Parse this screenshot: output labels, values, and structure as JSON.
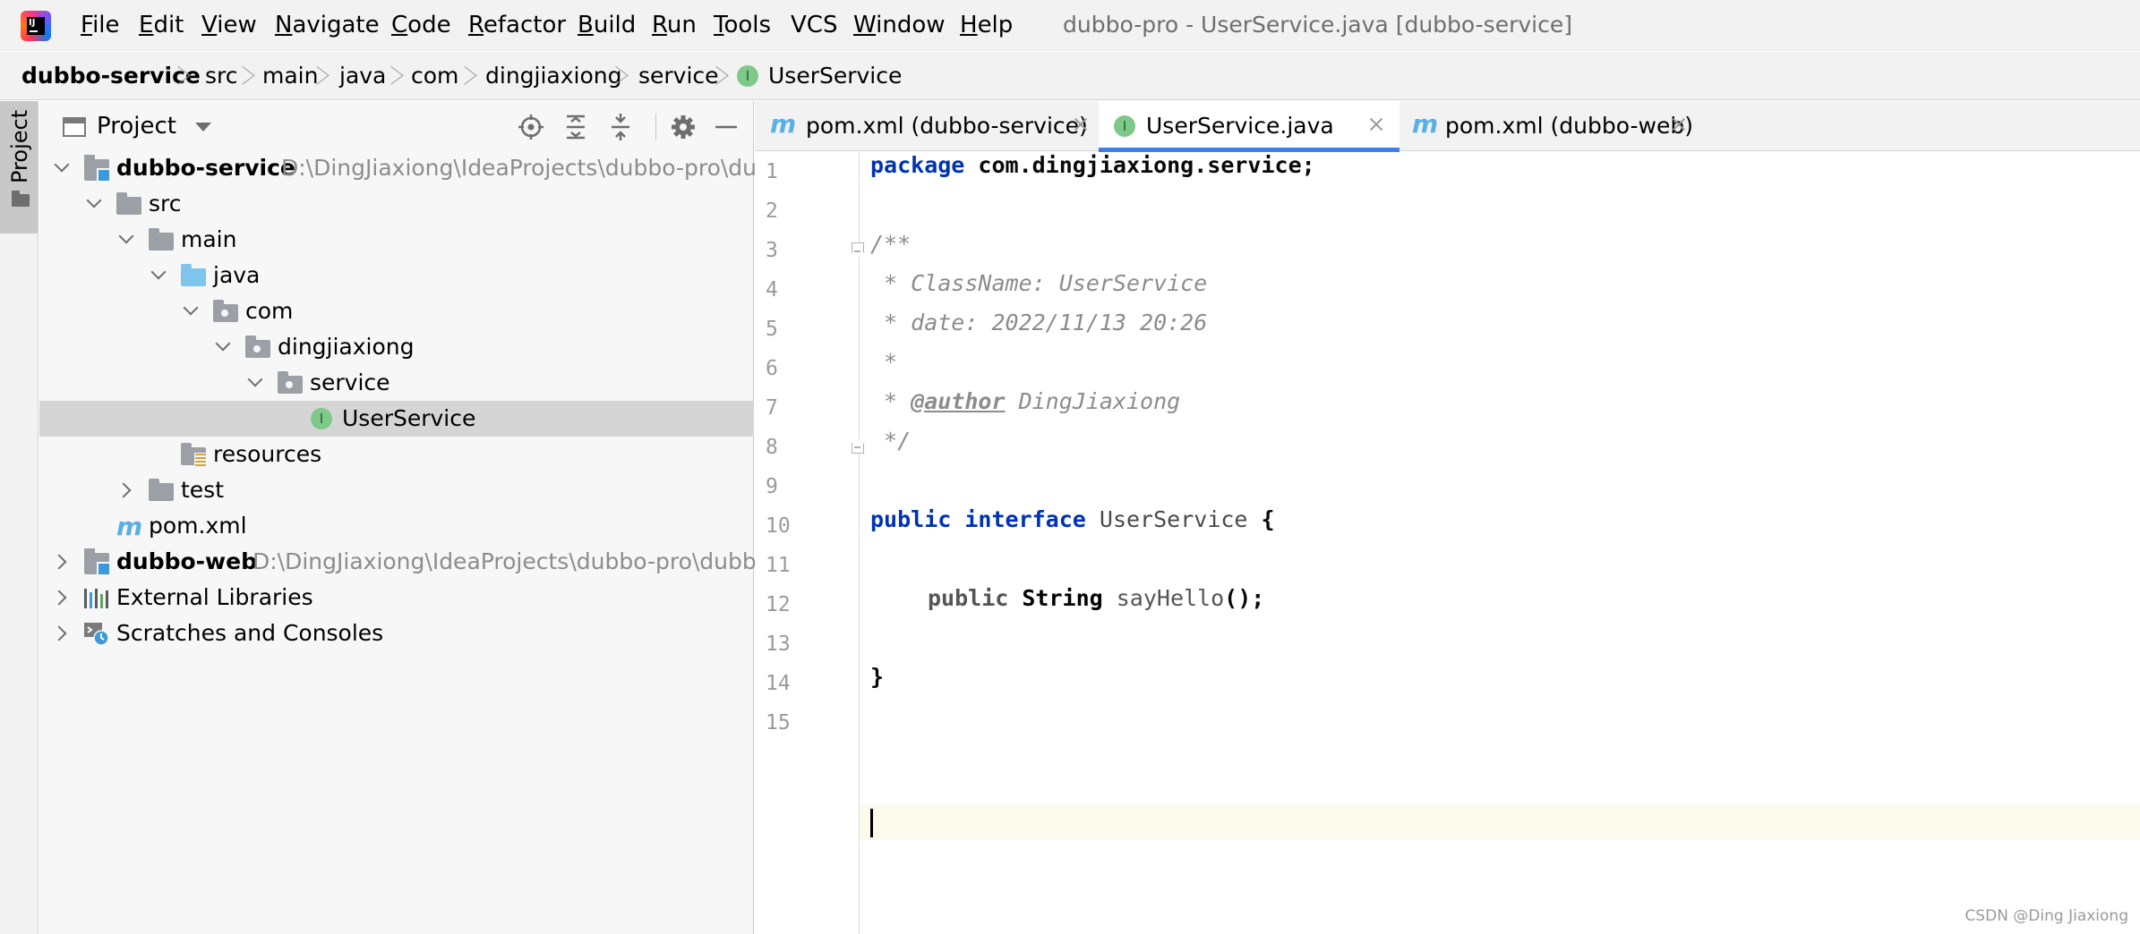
{
  "menubar": {
    "items": [
      {
        "label": "File",
        "mn": "F",
        "rest": "ile"
      },
      {
        "label": "Edit",
        "mn": "E",
        "rest": "dit"
      },
      {
        "label": "View",
        "mn": "V",
        "rest": "iew"
      },
      {
        "label": "Navigate",
        "mn": "N",
        "rest": "avigate"
      },
      {
        "label": "Code",
        "mn": "C",
        "rest": "ode"
      },
      {
        "label": "Refactor",
        "mn": "R",
        "rest": "efactor"
      },
      {
        "label": "Build",
        "mn": "B",
        "rest": "uild"
      },
      {
        "label": "Run",
        "mn": "R",
        "rest": "un"
      },
      {
        "label": "Tools",
        "mn": "T",
        "rest": "ools"
      },
      {
        "label": "VCS",
        "mn": "",
        "rest": "VCS"
      },
      {
        "label": "Window",
        "mn": "W",
        "rest": "indow"
      },
      {
        "label": "Help",
        "mn": "H",
        "rest": "elp"
      }
    ],
    "window_title": "dubbo-pro - UserService.java [dubbo-service]"
  },
  "breadcrumbs": [
    "dubbo-service",
    "src",
    "main",
    "java",
    "com",
    "dingjiaxiong",
    "service",
    "UserService"
  ],
  "stripe": {
    "label": "Project",
    "icon": "folder-icon"
  },
  "project_panel": {
    "title": "Project",
    "tools": [
      "locate-icon",
      "expand-all-icon",
      "collapse-all-icon",
      "gear-icon",
      "minimize-icon"
    ],
    "tree": [
      {
        "label": "dubbo-service",
        "path": "D:\\DingJiaxiong\\IdeaProjects\\dubbo-pro\\dubbo-service",
        "icon": "module-folder-icon",
        "expanded": true
      },
      {
        "label": "src",
        "icon": "folder-icon",
        "expanded": true
      },
      {
        "label": "main",
        "icon": "folder-icon",
        "expanded": true
      },
      {
        "label": "java",
        "icon": "source-root-folder-icon",
        "expanded": true
      },
      {
        "label": "com",
        "icon": "package-icon",
        "expanded": true
      },
      {
        "label": "dingjiaxiong",
        "icon": "package-icon",
        "expanded": true
      },
      {
        "label": "service",
        "icon": "package-icon",
        "expanded": true
      },
      {
        "label": "UserService",
        "icon": "interface-icon",
        "selected": true
      },
      {
        "label": "resources",
        "icon": "resources-folder-icon"
      },
      {
        "label": "test",
        "icon": "folder-icon",
        "expanded": false
      },
      {
        "label": "pom.xml",
        "icon": "maven-icon"
      },
      {
        "label": "dubbo-web",
        "path": "D:\\DingJiaxiong\\IdeaProjects\\dubbo-pro\\dubbo-web",
        "icon": "module-folder-icon",
        "expanded": false
      },
      {
        "label": "External Libraries",
        "icon": "libraries-icon",
        "expanded": false
      },
      {
        "label": "Scratches and Consoles",
        "icon": "scratches-icon",
        "expanded": false
      }
    ]
  },
  "editor": {
    "tabs": [
      {
        "label": "pom.xml (dubbo-service)",
        "icon": "maven-icon",
        "active": false
      },
      {
        "label": "UserService.java",
        "icon": "interface-icon",
        "active": true
      },
      {
        "label": "pom.xml (dubbo-web)",
        "icon": "maven-icon",
        "active": false
      }
    ],
    "line_numbers": [
      "1",
      "2",
      "3",
      "4",
      "5",
      "6",
      "7",
      "8",
      "9",
      "10",
      "11",
      "12",
      "13",
      "14",
      "15"
    ],
    "code": {
      "l1_kw": "package",
      "l1_rest": " com.dingjiaxiong.service;",
      "l3": "/**",
      "l4": " * ClassName: UserService",
      "l5": " * date: 2022/11/13 20:26",
      "l6": " *",
      "l7_pre": " * ",
      "l7_tag": "@author",
      "l7_rest": " DingJiaxiong",
      "l8": " */",
      "l10_kw1": "public",
      "l10_kw2": "interface",
      "l10_name": "UserService",
      "l10_brace": "{",
      "l12_kw": "public",
      "l12_type": "String",
      "l12_method": "sayHello",
      "l12_rest": "();",
      "l14": "}"
    },
    "caret_line": 15
  },
  "watermark": "CSDN @Ding Jiaxiong",
  "colors": {
    "keyword": "#0033b3",
    "comment": "#8c8c8c",
    "accent": "#3d7fe6",
    "caret_row": "#fcfaed"
  }
}
